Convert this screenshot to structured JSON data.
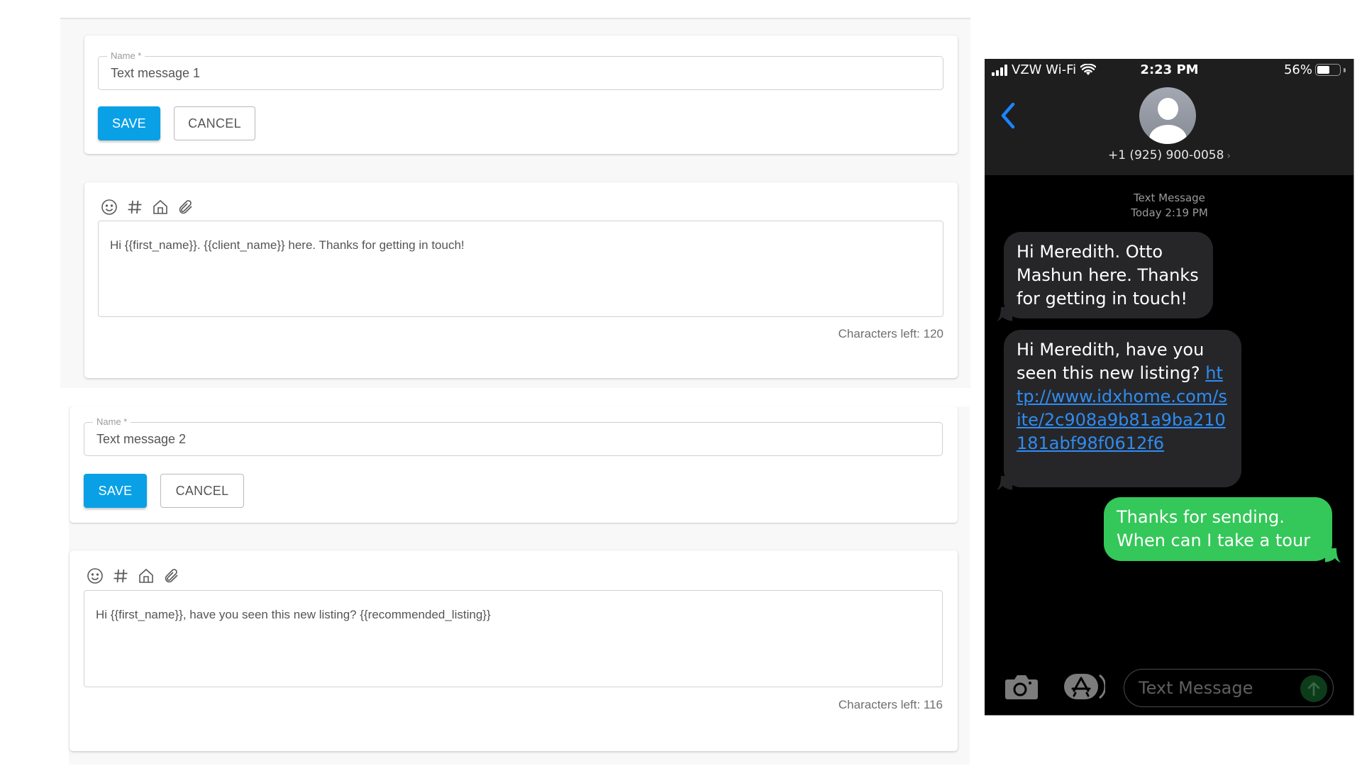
{
  "editor": {
    "templates": [
      {
        "name_label": "Name *",
        "name_value": "Text message 1",
        "save_label": "SAVE",
        "cancel_label": "CANCEL",
        "toolbar_icons": [
          "emoji-icon",
          "hashtag-icon",
          "home-icon",
          "paperclip-icon"
        ],
        "message": "Hi {{first_name}}. {{client_name}} here. Thanks for getting in touch!",
        "chars_left": "Characters left: 120"
      },
      {
        "name_label": "Name *",
        "name_value": "Text message 2",
        "save_label": "SAVE",
        "cancel_label": "CANCEL",
        "toolbar_icons": [
          "emoji-icon",
          "hashtag-icon",
          "home-icon",
          "paperclip-icon"
        ],
        "message": "Hi {{first_name}}, have you seen this new listing? {{recommended_listing}}",
        "chars_left": "Characters left: 116"
      }
    ],
    "colors": {
      "save": "#0aa0e6",
      "text": "#555555"
    }
  },
  "phone": {
    "status": {
      "carrier": "VZW Wi-Fi",
      "time": "2:23 PM",
      "battery": "56%",
      "battery_level": 0.56
    },
    "contact": {
      "number": "+1 (925) 900-0058",
      "chevron": "›"
    },
    "thread": {
      "type": "Text Message",
      "timestamp": "Today 2:19 PM",
      "messages": [
        {
          "direction": "incoming",
          "text": "Hi Meredith. Otto Mashun here. Thanks for getting in touch!"
        },
        {
          "direction": "incoming",
          "text": "Hi Meredith, have you seen this new listing?",
          "link": "http://www.idxhome.com/site/2c908a9b81a9ba210181abf98f0612f6"
        },
        {
          "direction": "outgoing",
          "text": "Thanks for sending. When can I take a tour"
        }
      ]
    },
    "compose": {
      "placeholder": "Text Message"
    },
    "colors": {
      "incoming": "#262629",
      "outgoing": "#34c759",
      "link": "#2f8cf0",
      "accent": "#1a84ff"
    }
  }
}
